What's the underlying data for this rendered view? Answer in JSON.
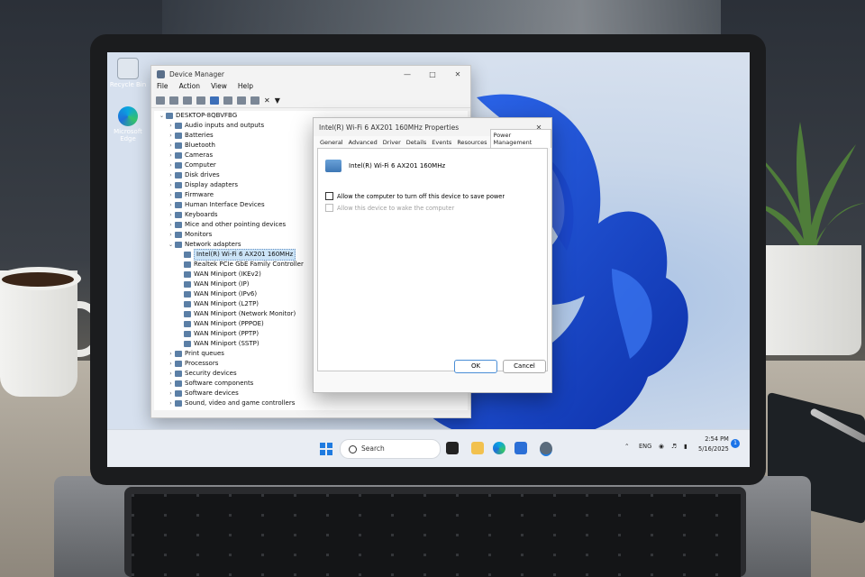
{
  "desktop": {
    "icons": [
      {
        "label": "Recycle Bin"
      },
      {
        "label": "Microsoft Edge"
      }
    ]
  },
  "device_manager": {
    "title": "Device Manager",
    "menu": [
      "File",
      "Action",
      "View",
      "Help"
    ],
    "tree": [
      {
        "label": "DESKTOP-8QBVFBG",
        "level": 0,
        "expanded": true
      },
      {
        "label": "Audio inputs and outputs",
        "level": 1
      },
      {
        "label": "Batteries",
        "level": 1
      },
      {
        "label": "Bluetooth",
        "level": 1
      },
      {
        "label": "Cameras",
        "level": 1
      },
      {
        "label": "Computer",
        "level": 1
      },
      {
        "label": "Disk drives",
        "level": 1
      },
      {
        "label": "Display adapters",
        "level": 1
      },
      {
        "label": "Firmware",
        "level": 1
      },
      {
        "label": "Human Interface Devices",
        "level": 1
      },
      {
        "label": "Keyboards",
        "level": 1
      },
      {
        "label": "Mice and other pointing devices",
        "level": 1
      },
      {
        "label": "Monitors",
        "level": 1
      },
      {
        "label": "Network adapters",
        "level": 1,
        "expanded": true
      },
      {
        "label": "Intel(R) Wi-Fi 6 AX201 160MHz",
        "level": 2,
        "selected": true
      },
      {
        "label": "Realtek PCIe GbE Family Controller",
        "level": 2
      },
      {
        "label": "WAN Miniport (IKEv2)",
        "level": 2
      },
      {
        "label": "WAN Miniport (IP)",
        "level": 2
      },
      {
        "label": "WAN Miniport (IPv6)",
        "level": 2
      },
      {
        "label": "WAN Miniport (L2TP)",
        "level": 2
      },
      {
        "label": "WAN Miniport (Network Monitor)",
        "level": 2
      },
      {
        "label": "WAN Miniport (PPPOE)",
        "level": 2
      },
      {
        "label": "WAN Miniport (PPTP)",
        "level": 2
      },
      {
        "label": "WAN Miniport (SSTP)",
        "level": 2
      },
      {
        "label": "Print queues",
        "level": 1
      },
      {
        "label": "Processors",
        "level": 1
      },
      {
        "label": "Security devices",
        "level": 1
      },
      {
        "label": "Software components",
        "level": 1
      },
      {
        "label": "Software devices",
        "level": 1
      },
      {
        "label": "Sound, video and game controllers",
        "level": 1
      }
    ]
  },
  "properties_dialog": {
    "title": "Intel(R) Wi-Fi 6 AX201 160MHz Properties",
    "tabs": [
      "General",
      "Advanced",
      "Driver",
      "Details",
      "Events",
      "Resources",
      "Power Management"
    ],
    "active_tab": "Power Management",
    "device_name": "Intel(R) Wi-Fi 6 AX201 160MHz",
    "options": [
      {
        "label": "Allow the computer to turn off this device to save power",
        "checked": false,
        "enabled": true
      },
      {
        "label": "Allow this device to wake the computer",
        "checked": false,
        "enabled": false
      }
    ],
    "ok_label": "OK",
    "cancel_label": "Cancel"
  },
  "taskbar": {
    "search_placeholder": "Search",
    "language": "ENG",
    "time": "2:54 PM",
    "date": "5/16/2025",
    "notification_count": "1"
  },
  "colors": {
    "accent": "#1f7be0",
    "selection": "#cce4f7",
    "wallpaper_bloom": "#1f4fd8"
  }
}
